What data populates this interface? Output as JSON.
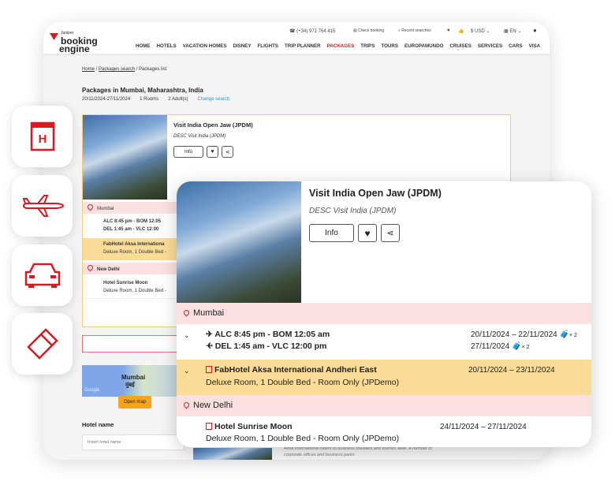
{
  "header": {
    "brand_small": "Juniper",
    "brand_line1": "booking",
    "brand_line2": "engine",
    "phone": "(+34) 971 764 415",
    "check_booking": "Check booking",
    "recent_searches": "Recent searches",
    "currency": "$ USD",
    "language": "EN",
    "nav": [
      "HOME",
      "HOTELS",
      "VACATION HOMES",
      "DISNEY",
      "FLIGHTS",
      "TRIP PLANNER",
      "PACKAGES",
      "TRIPS",
      "TOURS",
      "EUROPAMUNDO",
      "CRUISES",
      "SERVICES",
      "CARS",
      "VISA"
    ]
  },
  "breadcrumb": [
    "Home",
    "Packages search",
    "Packages list"
  ],
  "search": {
    "title": "Packages in Mumbai, Maharashtra, India",
    "dates": "20/11/2024-27/11/2024",
    "rooms": "1 Rooms",
    "adults": "2 Adult(s)",
    "change": "Change search"
  },
  "package": {
    "title": "Visit India Open Jaw (JPDM)",
    "desc": "DESC Visit India (JPDM)",
    "info": "Info",
    "city1": "Mumbai",
    "flight_out": "ALC 8:45 pm - BOM 12:05 am",
    "flight_out_dates": "20/11/2024 – 22/11/2024",
    "flight_back": "DEL 1:45 am - VLC 12:00 pm",
    "flight_back_date": "27/11/2024",
    "bags": "× 2",
    "hotel1": "FabHotel Aksa International Andheri East",
    "hotel1_room": "Deluxe Room, 1 Double Bed - Room Only (JPDemo)",
    "hotel1_dates": "20/11/2024 – 23/11/2024",
    "city2": "New Delhi",
    "hotel2": "Hotel Sunrise Moon",
    "hotel2_room": "Deluxe Room, 1 Double Bed - Room Only (JPDemo)",
    "hotel2_dates": "24/11/2024 – 27/11/2024",
    "short_flight_out": "ALC 8:45 pm - BOM 12:05",
    "short_flight_back": "DEL 1:45 am - VLC 12:00",
    "short_hotel1": "FabHotel Aksa Internationa",
    "short_room": "Deluxe Room, 1 Double Bed -"
  },
  "map": {
    "city": "Mumbai",
    "city_local": "मुंबई",
    "google": "Google",
    "open": "Open map"
  },
  "filter": {
    "label": "Hotel name",
    "placeholder": "Insert hotel name"
  },
  "hotel_desc": "Aksa International caters to business travelers and tourists alike. A number of corporate offices and business parks",
  "colors": {
    "brand": "#d71920",
    "pink": "#fbe0e2",
    "yellow": "#fbdc97",
    "link": "#1a9bd7"
  }
}
